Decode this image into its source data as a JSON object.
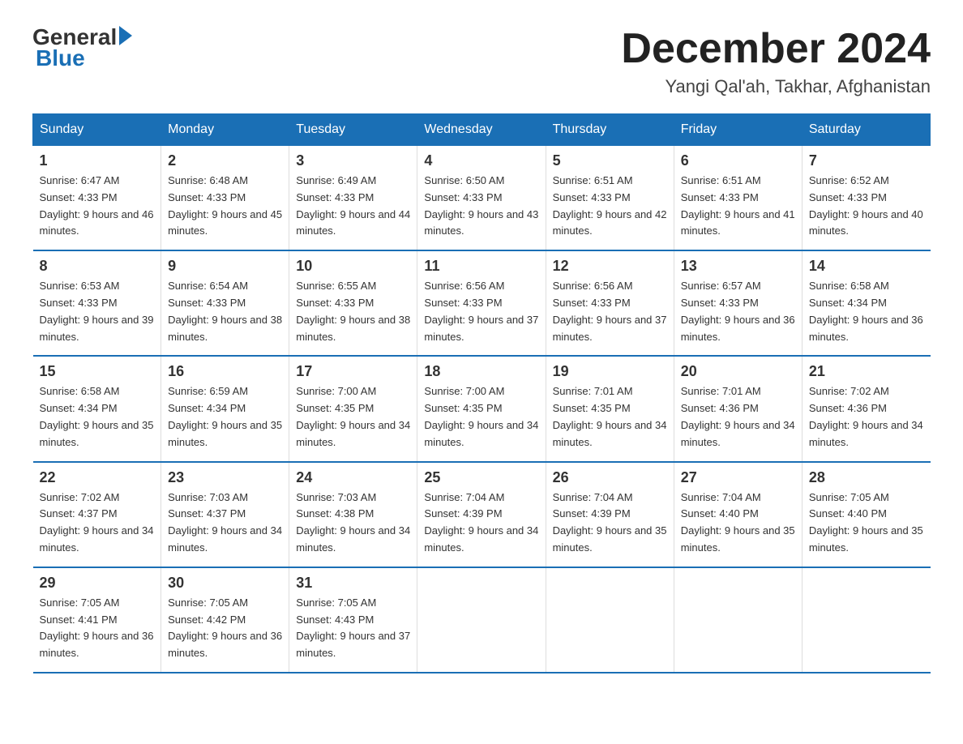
{
  "logo": {
    "general": "General",
    "blue": "Blue"
  },
  "title": "December 2024",
  "location": "Yangi Qal'ah, Takhar, Afghanistan",
  "days_of_week": [
    "Sunday",
    "Monday",
    "Tuesday",
    "Wednesday",
    "Thursday",
    "Friday",
    "Saturday"
  ],
  "weeks": [
    [
      {
        "day": "1",
        "sunrise": "6:47 AM",
        "sunset": "4:33 PM",
        "daylight": "9 hours and 46 minutes."
      },
      {
        "day": "2",
        "sunrise": "6:48 AM",
        "sunset": "4:33 PM",
        "daylight": "9 hours and 45 minutes."
      },
      {
        "day": "3",
        "sunrise": "6:49 AM",
        "sunset": "4:33 PM",
        "daylight": "9 hours and 44 minutes."
      },
      {
        "day": "4",
        "sunrise": "6:50 AM",
        "sunset": "4:33 PM",
        "daylight": "9 hours and 43 minutes."
      },
      {
        "day": "5",
        "sunrise": "6:51 AM",
        "sunset": "4:33 PM",
        "daylight": "9 hours and 42 minutes."
      },
      {
        "day": "6",
        "sunrise": "6:51 AM",
        "sunset": "4:33 PM",
        "daylight": "9 hours and 41 minutes."
      },
      {
        "day": "7",
        "sunrise": "6:52 AM",
        "sunset": "4:33 PM",
        "daylight": "9 hours and 40 minutes."
      }
    ],
    [
      {
        "day": "8",
        "sunrise": "6:53 AM",
        "sunset": "4:33 PM",
        "daylight": "9 hours and 39 minutes."
      },
      {
        "day": "9",
        "sunrise": "6:54 AM",
        "sunset": "4:33 PM",
        "daylight": "9 hours and 38 minutes."
      },
      {
        "day": "10",
        "sunrise": "6:55 AM",
        "sunset": "4:33 PM",
        "daylight": "9 hours and 38 minutes."
      },
      {
        "day": "11",
        "sunrise": "6:56 AM",
        "sunset": "4:33 PM",
        "daylight": "9 hours and 37 minutes."
      },
      {
        "day": "12",
        "sunrise": "6:56 AM",
        "sunset": "4:33 PM",
        "daylight": "9 hours and 37 minutes."
      },
      {
        "day": "13",
        "sunrise": "6:57 AM",
        "sunset": "4:33 PM",
        "daylight": "9 hours and 36 minutes."
      },
      {
        "day": "14",
        "sunrise": "6:58 AM",
        "sunset": "4:34 PM",
        "daylight": "9 hours and 36 minutes."
      }
    ],
    [
      {
        "day": "15",
        "sunrise": "6:58 AM",
        "sunset": "4:34 PM",
        "daylight": "9 hours and 35 minutes."
      },
      {
        "day": "16",
        "sunrise": "6:59 AM",
        "sunset": "4:34 PM",
        "daylight": "9 hours and 35 minutes."
      },
      {
        "day": "17",
        "sunrise": "7:00 AM",
        "sunset": "4:35 PM",
        "daylight": "9 hours and 34 minutes."
      },
      {
        "day": "18",
        "sunrise": "7:00 AM",
        "sunset": "4:35 PM",
        "daylight": "9 hours and 34 minutes."
      },
      {
        "day": "19",
        "sunrise": "7:01 AM",
        "sunset": "4:35 PM",
        "daylight": "9 hours and 34 minutes."
      },
      {
        "day": "20",
        "sunrise": "7:01 AM",
        "sunset": "4:36 PM",
        "daylight": "9 hours and 34 minutes."
      },
      {
        "day": "21",
        "sunrise": "7:02 AM",
        "sunset": "4:36 PM",
        "daylight": "9 hours and 34 minutes."
      }
    ],
    [
      {
        "day": "22",
        "sunrise": "7:02 AM",
        "sunset": "4:37 PM",
        "daylight": "9 hours and 34 minutes."
      },
      {
        "day": "23",
        "sunrise": "7:03 AM",
        "sunset": "4:37 PM",
        "daylight": "9 hours and 34 minutes."
      },
      {
        "day": "24",
        "sunrise": "7:03 AM",
        "sunset": "4:38 PM",
        "daylight": "9 hours and 34 minutes."
      },
      {
        "day": "25",
        "sunrise": "7:04 AM",
        "sunset": "4:39 PM",
        "daylight": "9 hours and 34 minutes."
      },
      {
        "day": "26",
        "sunrise": "7:04 AM",
        "sunset": "4:39 PM",
        "daylight": "9 hours and 35 minutes."
      },
      {
        "day": "27",
        "sunrise": "7:04 AM",
        "sunset": "4:40 PM",
        "daylight": "9 hours and 35 minutes."
      },
      {
        "day": "28",
        "sunrise": "7:05 AM",
        "sunset": "4:40 PM",
        "daylight": "9 hours and 35 minutes."
      }
    ],
    [
      {
        "day": "29",
        "sunrise": "7:05 AM",
        "sunset": "4:41 PM",
        "daylight": "9 hours and 36 minutes."
      },
      {
        "day": "30",
        "sunrise": "7:05 AM",
        "sunset": "4:42 PM",
        "daylight": "9 hours and 36 minutes."
      },
      {
        "day": "31",
        "sunrise": "7:05 AM",
        "sunset": "4:43 PM",
        "daylight": "9 hours and 37 minutes."
      },
      null,
      null,
      null,
      null
    ]
  ],
  "sunrise_label": "Sunrise:",
  "sunset_label": "Sunset:",
  "daylight_label": "Daylight:"
}
